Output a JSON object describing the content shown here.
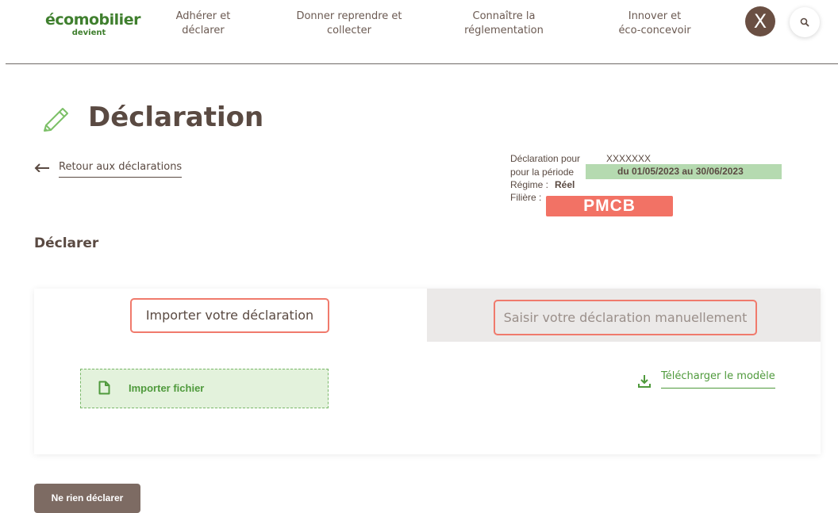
{
  "header": {
    "logo_main": "écomobilier",
    "logo_sub": "devient",
    "nav": [
      {
        "line1": "Adhérer et",
        "line2": "déclarer"
      },
      {
        "line1": "Donner reprendre et",
        "line2": "collecter"
      },
      {
        "line1": "Connaître la",
        "line2": "réglementation"
      },
      {
        "line1": "Innover et",
        "line2": "éco-concevoir"
      }
    ],
    "avatar_letter": "X",
    "search_icon": "search-icon"
  },
  "page": {
    "title": "Déclaration",
    "title_icon": "pencil-icon",
    "back_label": "Retour aux déclarations"
  },
  "info": {
    "declaration_label": "Déclaration pour",
    "declaration_value": "XXXXXXX",
    "period_label": "pour la période",
    "period_value": "du 01/05/2023 au 30/06/2023",
    "regime_label": "Régime :",
    "regime_value": "Réel",
    "filiere_label": "Filière :",
    "filiere_value": "PMCB"
  },
  "colors": {
    "brand_green": "#3f7f2e",
    "accent_green": "#4f9a3c",
    "period_highlight": "#b5dab0",
    "filiere_badge": "#f27265",
    "tab_border": "#f07a6c",
    "button_brown": "#7d6b63"
  },
  "declare": {
    "section_title": "Déclarer",
    "tab_import": "Importer votre déclaration",
    "tab_manual": "Saisir votre déclaration manuellement",
    "import_file_label": "Importer fichier",
    "download_label": "Télécharger le modèle",
    "no_declare_button": "Ne rien déclarer"
  }
}
